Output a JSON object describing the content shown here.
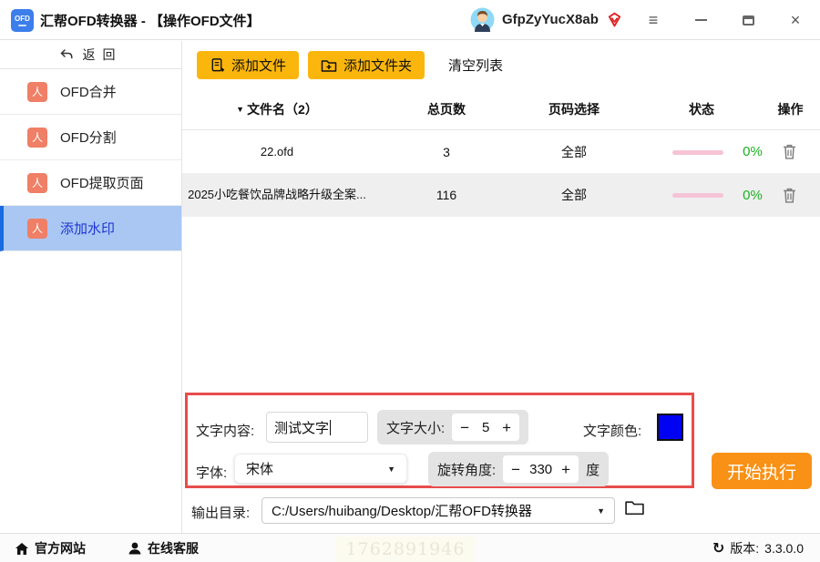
{
  "window": {
    "title": "汇帮OFD转换器 - 【操作OFD文件】",
    "app_icon_text": "OFD",
    "username": "GfpZyYucX8ab",
    "controls": {
      "menu": "≡",
      "close": "×"
    }
  },
  "icons": {
    "sort": "▼",
    "dropdown": "▼"
  },
  "sidebar": {
    "back_label": "返回",
    "items": [
      {
        "label": "OFD合并"
      },
      {
        "label": "OFD分割"
      },
      {
        "label": "OFD提取页面"
      },
      {
        "label": "添加水印"
      }
    ]
  },
  "toolbar": {
    "add_file": "添加文件",
    "add_folder": "添加文件夹",
    "clear_list": "清空列表"
  },
  "table": {
    "headers": {
      "name": "文件名（2）",
      "pages": "总页数",
      "page_select": "页码选择",
      "status": "状态",
      "action": "操作"
    },
    "rows": [
      {
        "name": "22.ofd",
        "pages": "3",
        "page_select": "全部",
        "percent": "0%"
      },
      {
        "name": "2025小吃餐饮品牌战略升级全案...",
        "pages": "116",
        "page_select": "全部",
        "percent": "0%"
      }
    ]
  },
  "panel": {
    "text_label": "文字内容:",
    "text_value": "测试文字",
    "size_label": "文字大小:",
    "size_value": "5",
    "minus": "−",
    "plus": "+",
    "color_label": "文字颜色:",
    "color_value": "#0202f2",
    "font_label": "字体:",
    "font_value": "宋体",
    "angle_label": "旋转角度:",
    "angle_value": "330",
    "angle_unit": "度"
  },
  "output": {
    "label": "输出目录:",
    "path": "C:/Users/huibang/Desktop/汇帮OFD转换器"
  },
  "start_button": "开始执行",
  "footer": {
    "website": "官方网站",
    "support": "在线客服",
    "version_label": "版本:",
    "version": "3.3.0.0",
    "watermark": "1762891946"
  },
  "colors": {
    "accent_amber": "#fbb60d",
    "start_orange": "#f89116",
    "panel_border_red": "#e84c4c",
    "selected_item_blue": "#a9c7f2",
    "nav_icon_salmon": "#ef7f66",
    "progress_pink": "#f5c3d5",
    "percent_green": "#1cb021",
    "swatch_blue": "#0202f2",
    "app_icon_blue": "#3c7eeb"
  }
}
